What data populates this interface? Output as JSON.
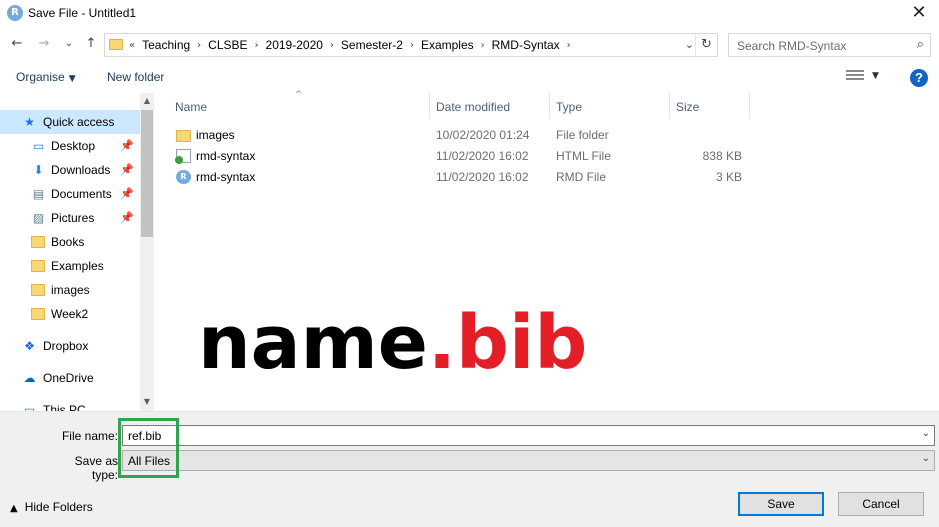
{
  "window": {
    "title": "Save File - Untitled1",
    "app_icon_letter": "R",
    "close_glyph": "✕"
  },
  "nav": {
    "back_glyph": "←",
    "forward_glyph": "→",
    "recent_glyph": "⌄",
    "up_glyph": "↑",
    "address_prefix": "«",
    "breadcrumbs": [
      "Teaching",
      "CLSBE",
      "2019-2020",
      "Semester-2",
      "Examples",
      "RMD-Syntax"
    ],
    "separator_glyph": "›",
    "dropdown_glyph": "⌄",
    "refresh_glyph": "↻",
    "search_placeholder": "Search RMD-Syntax",
    "search_glyph": "⌕"
  },
  "toolbar": {
    "organise_label": "Organise",
    "organise_caret": "▼",
    "new_folder_label": "New folder",
    "view_caret": "▼",
    "help_glyph": "?"
  },
  "sidebar": {
    "items": [
      {
        "label": "Quick access",
        "icon": "star-icon",
        "glyph": "★",
        "pinned": false
      },
      {
        "label": "Desktop",
        "icon": "desktop-icon",
        "glyph": "▭",
        "pinned": true
      },
      {
        "label": "Downloads",
        "icon": "download-icon",
        "glyph": "⬇",
        "pinned": true
      },
      {
        "label": "Documents",
        "icon": "documents-icon",
        "glyph": "▤",
        "pinned": true
      },
      {
        "label": "Pictures",
        "icon": "pictures-icon",
        "glyph": "▨",
        "pinned": true
      },
      {
        "label": "Books",
        "icon": "folder-icon",
        "pinned": false
      },
      {
        "label": "Examples",
        "icon": "folder-icon",
        "pinned": false
      },
      {
        "label": "images",
        "icon": "folder-icon",
        "pinned": false
      },
      {
        "label": "Week2",
        "icon": "folder-icon",
        "pinned": false
      },
      {
        "label": "Dropbox",
        "icon": "dropbox-icon",
        "glyph": "❖",
        "pinned": false
      },
      {
        "label": "OneDrive",
        "icon": "cloud-icon",
        "glyph": "☁",
        "pinned": false
      },
      {
        "label": "This PC",
        "icon": "computer-icon",
        "glyph": "▭",
        "pinned": false
      }
    ],
    "pin_glyph": "📌",
    "scroll_up_glyph": "▲",
    "scroll_down_glyph": "▼"
  },
  "file_list": {
    "sort_caret": "^",
    "columns": {
      "name": "Name",
      "date": "Date modified",
      "type": "Type",
      "size": "Size"
    },
    "rows": [
      {
        "name": "images",
        "date": "10/02/2020 01:24",
        "type": "File folder",
        "size": "",
        "icon": "folder-icon"
      },
      {
        "name": "rmd-syntax",
        "date": "11/02/2020 16:02",
        "type": "HTML File",
        "size": "838 KB",
        "icon": "html-file-icon"
      },
      {
        "name": "rmd-syntax",
        "date": "11/02/2020 16:02",
        "type": "RMD File",
        "size": "3 KB",
        "icon": "rmd-file-icon",
        "icon_letter": "R"
      }
    ]
  },
  "overlay": {
    "base": "name",
    "dot": ".",
    "ext": "bib",
    "base_color": "#000000",
    "ext_color": "#e41e26"
  },
  "save_form": {
    "file_name_label": "File name:",
    "file_name_value": "ref.bib",
    "save_as_type_label": "Save as type:",
    "save_as_type_value": "All Files",
    "dropdown_glyph": "⌄",
    "highlight_color": "#2ea44f"
  },
  "footer": {
    "hide_folders_caret": "▲",
    "hide_folders_label": "Hide Folders",
    "save_label": "Save",
    "cancel_label": "Cancel"
  }
}
